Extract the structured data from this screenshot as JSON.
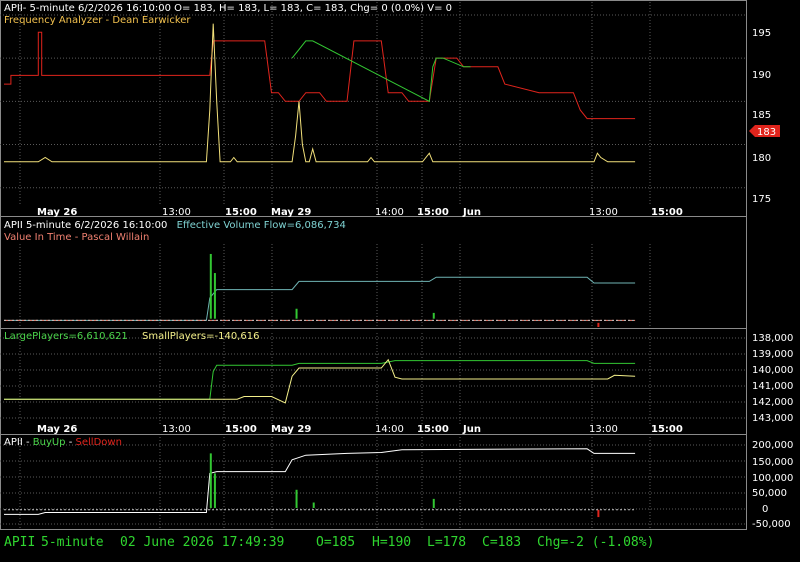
{
  "colors": {
    "background": "#000000",
    "grid": "#5a5a5a",
    "frame": "#8a8a8a",
    "price": "#e0241c",
    "freq": "#f2e07a",
    "green": "#33c733",
    "teal": "#6fb4b4",
    "yellow": "#f4f08a",
    "white": "#ffffff",
    "red_bar": "#e0241c",
    "status": "#2fd62f",
    "title_white": "#ffffff",
    "title_orange": "#f2c14e",
    "title_cyan": "#7fd3d3",
    "title_salmon": "#f08070",
    "title_green": "#4cd64c",
    "title_yellow": "#f4f08a",
    "title_red": "#e0241c"
  },
  "panes": {
    "p1": {
      "title_line": "APII- 5-minute 6/2/2026 16:10:00 O= 183, H= 183, L= 183, C= 183, Chg= 0 (0.0%) V= 0",
      "indicator": "Frequency Analyzer - Dean Earwicker",
      "price_badge": "183"
    },
    "p2": {
      "title_prefix": "APII 5-minute  6/2/2026 16:10:00",
      "indicator_a": "Effective Volume Flow=6,086,734",
      "indicator_b": "Value In Time - Pascal Willain"
    },
    "p3": {
      "label_large": "LargePlayers=6,610,621",
      "label_small": "SmallPlayers=-140,616"
    },
    "p4": {
      "title_prefix": "APII - ",
      "buy": "BuyUp",
      "sep": "-",
      "sell": "SellDown"
    }
  },
  "dates": {
    "d1": "May 26",
    "t1": "13:00",
    "t2": "15:00",
    "d2": "May 29",
    "t3": "14:00",
    "t4": "15:00",
    "d3": "Jun",
    "t5": "13:00",
    "t6": "15:00"
  },
  "status": {
    "symbol": "APII",
    "interval": "5-minute",
    "datetime": "02 June 2026 17:49:39",
    "open": "O=185",
    "high": "H=190",
    "low": "L=178",
    "close": "C=183",
    "change": "Chg=-2 (-1.08%)"
  },
  "chart_data": [
    {
      "type": "line",
      "title": "Frequency Analyzer - Dean Earwicker",
      "y_ticks": [
        "175",
        "180",
        "185",
        "190",
        "195"
      ],
      "ylim": [
        173,
        196.5
      ],
      "x_range": [
        0,
        100
      ],
      "series": [
        {
          "name": "APII",
          "color": "#e0241c",
          "points": [
            [
              0,
              187
            ],
            [
              1,
              187
            ],
            [
              1,
              188
            ],
            [
              5,
              188
            ],
            [
              5,
              193
            ],
            [
              5.5,
              193
            ],
            [
              5.5,
              188
            ],
            [
              30,
              188
            ],
            [
              30.5,
              192
            ],
            [
              38,
              192
            ],
            [
              39,
              186
            ],
            [
              40,
              186
            ],
            [
              41,
              185
            ],
            [
              43,
              185
            ],
            [
              44,
              186
            ],
            [
              46,
              186
            ],
            [
              47,
              185
            ],
            [
              50,
              185
            ],
            [
              51,
              192
            ],
            [
              55,
              192
            ],
            [
              56,
              186
            ],
            [
              58,
              186
            ],
            [
              59,
              185
            ],
            [
              62,
              185
            ],
            [
              63,
              190
            ],
            [
              66,
              190
            ],
            [
              67,
              189
            ],
            [
              72,
              189
            ],
            [
              73,
              187
            ],
            [
              78,
              186
            ],
            [
              83,
              186
            ],
            [
              84,
              184
            ],
            [
              85,
              183
            ],
            [
              87,
              183
            ],
            [
              88,
              183
            ],
            [
              92,
              183
            ]
          ]
        },
        {
          "name": "Green",
          "color": "#33c733",
          "points": [
            [
              42,
              190
            ],
            [
              43,
              191
            ],
            [
              44,
              192
            ],
            [
              45,
              192
            ],
            [
              62,
              185
            ],
            [
              62.5,
              189
            ],
            [
              63,
              190
            ],
            [
              64,
              190
            ],
            [
              67,
              189
            ],
            [
              68,
              189
            ]
          ]
        },
        {
          "name": "Frequency",
          "color": "#f2e07a",
          "points": [
            [
              0,
              178
            ],
            [
              5,
              178
            ],
            [
              6,
              178.5
            ],
            [
              7,
              178
            ],
            [
              24,
              178
            ],
            [
              29,
              178
            ],
            [
              29.5,
              178
            ],
            [
              30,
              184
            ],
            [
              30.5,
              194
            ],
            [
              31,
              185
            ],
            [
              31.5,
              178
            ],
            [
              33,
              178
            ],
            [
              33.5,
              178.5
            ],
            [
              34,
              178
            ],
            [
              41,
              178
            ],
            [
              42,
              178
            ],
            [
              42.5,
              181
            ],
            [
              43,
              185
            ],
            [
              43.5,
              180
            ],
            [
              44,
              178
            ],
            [
              44.5,
              178
            ],
            [
              45,
              179.5
            ],
            [
              45.5,
              178
            ],
            [
              48,
              178
            ],
            [
              53,
              178
            ],
            [
              53.5,
              178.5
            ],
            [
              54,
              178
            ],
            [
              61,
              178
            ],
            [
              62,
              179
            ],
            [
              62.5,
              178
            ],
            [
              70,
              178
            ],
            [
              72,
              178
            ],
            [
              74,
              178
            ],
            [
              86,
              178
            ],
            [
              86.5,
              179
            ],
            [
              87,
              178.5
            ],
            [
              88,
              178
            ],
            [
              92,
              178
            ]
          ]
        }
      ]
    },
    {
      "type": "line",
      "title": "Effective Volume Flow=6,086,734",
      "series": [
        {
          "name": "Effective Volume Flow",
          "color": "#6fb4b4",
          "points": [
            [
              0,
              0.92
            ],
            [
              29.5,
              0.92
            ],
            [
              30,
              0.65
            ],
            [
              31,
              0.55
            ],
            [
              42,
              0.55
            ],
            [
              43,
              0.45
            ],
            [
              44,
              0.45
            ],
            [
              45,
              0.45
            ],
            [
              62,
              0.45
            ],
            [
              63,
              0.4
            ],
            [
              85,
              0.4
            ],
            [
              86,
              0.47
            ],
            [
              92,
              0.47
            ]
          ]
        },
        {
          "name": "Value In Time",
          "color": "#f08070",
          "points": [
            [
              0,
              0.92
            ],
            [
              92,
              0.92
            ]
          ]
        }
      ]
    },
    {
      "type": "line",
      "title": "LargePlayers / SmallPlayers",
      "y_ticks": [
        "138,000",
        "139,000",
        "140,000",
        "141,000",
        "142,000",
        "143,000"
      ],
      "series": [
        {
          "name": "LargePlayers",
          "color": "#33c733",
          "points": [
            [
              0,
              0.72
            ],
            [
              30,
              0.72
            ],
            [
              30.5,
              0.42
            ],
            [
              31,
              0.35
            ],
            [
              42,
              0.35
            ],
            [
              43,
              0.33
            ],
            [
              55,
              0.33
            ],
            [
              57,
              0.3
            ],
            [
              85,
              0.3
            ],
            [
              86,
              0.33
            ],
            [
              92,
              0.33
            ]
          ]
        },
        {
          "name": "SmallPlayers",
          "color": "#f4f08a",
          "points": [
            [
              0,
              0.72
            ],
            [
              30,
              0.72
            ],
            [
              34,
              0.72
            ],
            [
              35,
              0.69
            ],
            [
              39,
              0.69
            ],
            [
              41,
              0.76
            ],
            [
              42,
              0.47
            ],
            [
              43,
              0.38
            ],
            [
              55,
              0.38
            ],
            [
              56,
              0.29
            ],
            [
              57,
              0.48
            ],
            [
              58,
              0.5
            ],
            [
              85,
              0.5
            ],
            [
              88,
              0.5
            ],
            [
              89,
              0.46
            ],
            [
              92,
              0.47
            ]
          ]
        }
      ]
    },
    {
      "type": "line",
      "title": "BuyUp-SellDown",
      "y_ticks": [
        "200,000",
        "150,000",
        "100,000",
        "50,000",
        "0",
        "-50,000"
      ],
      "series": [
        {
          "name": "BuyUp-SellDown",
          "color": "#ffffff",
          "points": [
            [
              0,
              0.85
            ],
            [
              5,
              0.85
            ],
            [
              6,
              0.83
            ],
            [
              29.5,
              0.83
            ],
            [
              30,
              0.4
            ],
            [
              31,
              0.38
            ],
            [
              41,
              0.38
            ],
            [
              42,
              0.25
            ],
            [
              44,
              0.2
            ],
            [
              50,
              0.18
            ],
            [
              55,
              0.17
            ],
            [
              58,
              0.14
            ],
            [
              85,
              0.13
            ],
            [
              86,
              0.18
            ],
            [
              92,
              0.18
            ]
          ]
        }
      ]
    }
  ]
}
